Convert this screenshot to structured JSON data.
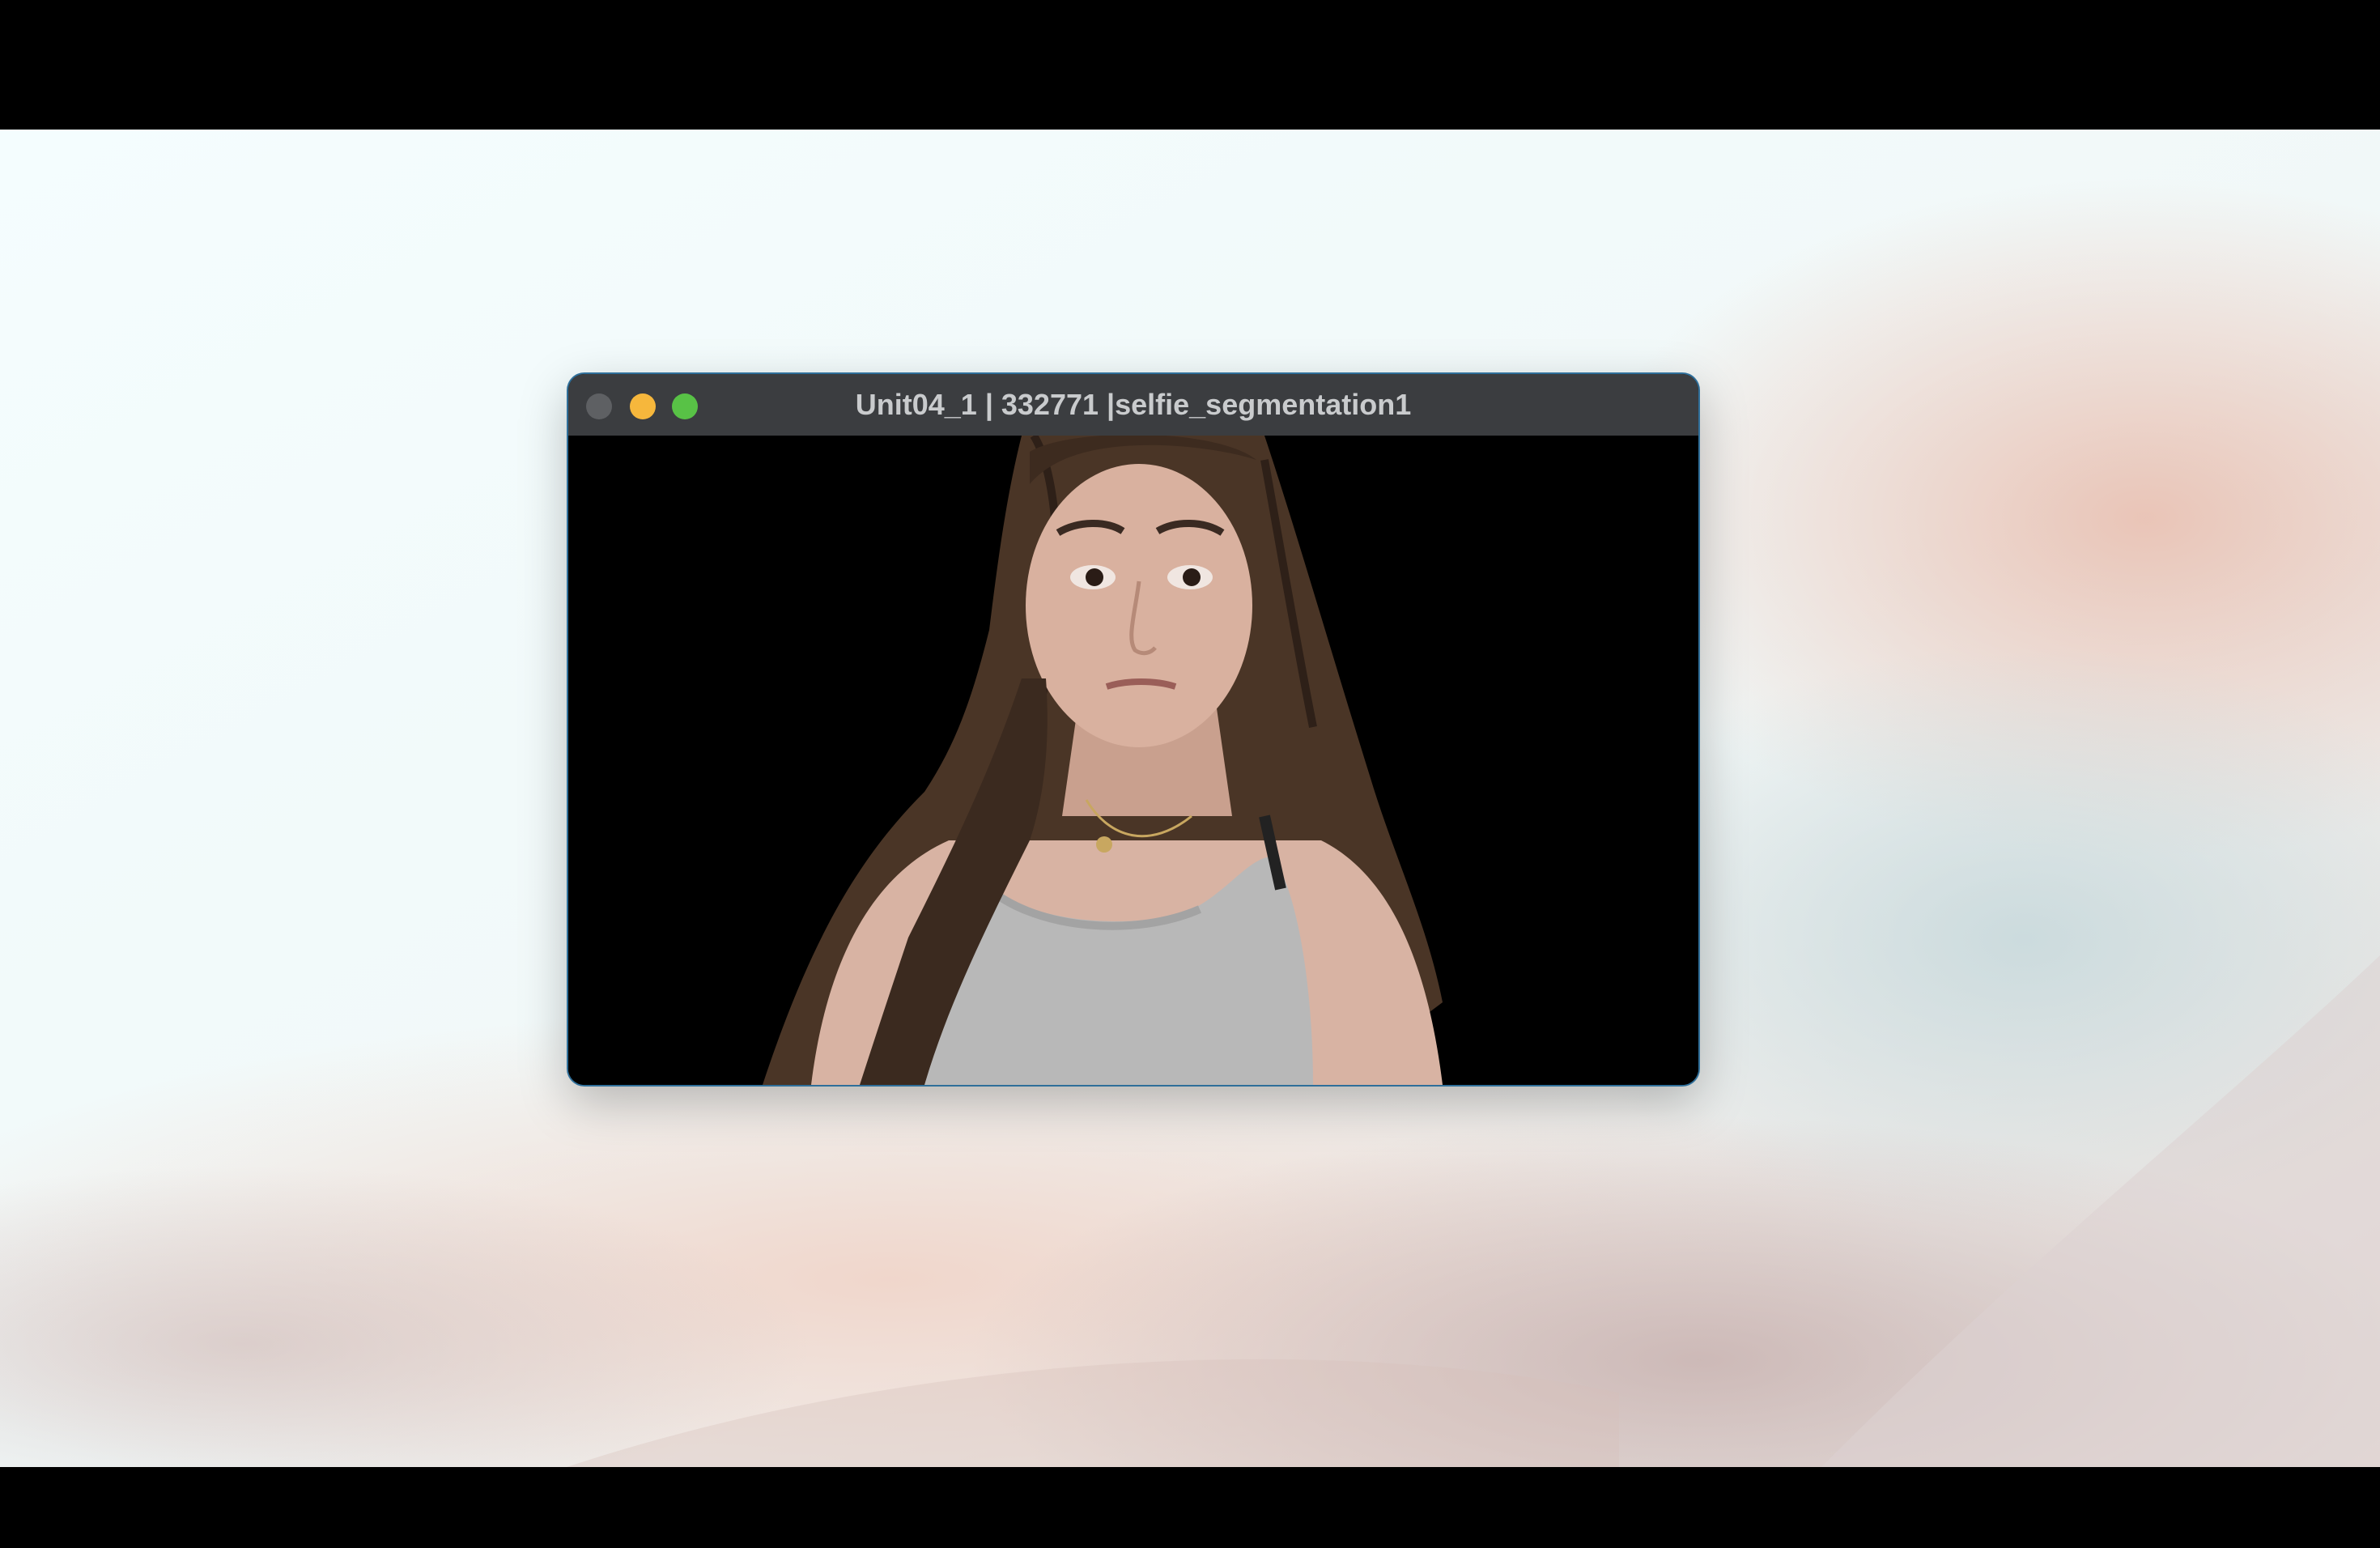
{
  "window": {
    "title": "Unit04_1 | 332771 |selfie_segmentation1"
  },
  "traffic_lights": {
    "close_color": "#5e6063",
    "minimize_color": "#f6b73c",
    "zoom_color": "#58c246"
  },
  "video": {
    "content": "segmented-person-feed",
    "background_color": "#000000"
  },
  "icons": [
    "close-icon",
    "minimize-icon",
    "zoom-icon"
  ]
}
